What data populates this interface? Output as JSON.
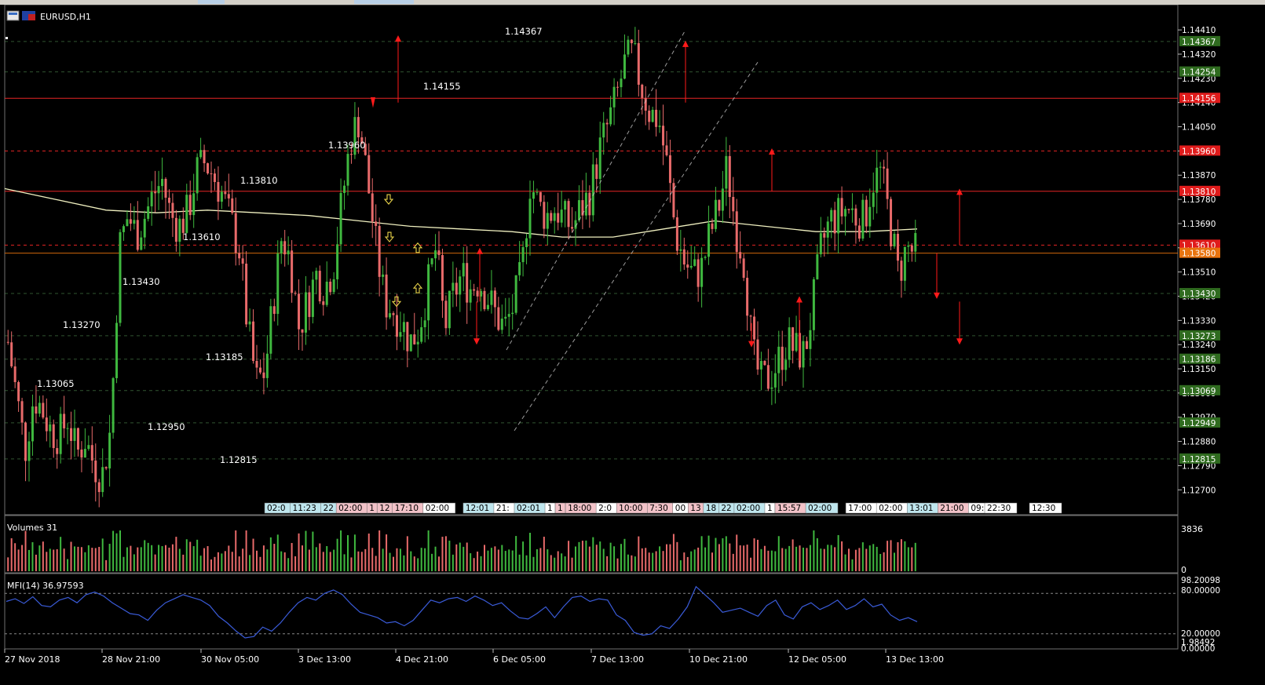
{
  "window": {
    "symbol_label": "EURUSD,H1"
  },
  "colors": {
    "background": "#000000",
    "bull": "#3fb83f",
    "bear": "#e86a6a",
    "resistance": "#ff2a2a",
    "support_dash": "#5a9a5a",
    "ma": "#f0f0c0",
    "mfi": "#3a5bd8",
    "price_green": "#2f6b1f",
    "price_red": "#e01b1b",
    "price_orange": "#e8730e",
    "arrow_red": "#ff1a1a",
    "arrow_yellow": "#e8d24a"
  },
  "chart_data": {
    "type": "candlestick",
    "symbol": "EURUSD",
    "timeframe": "H1",
    "ylim": [
      1.1266,
      1.1446
    ],
    "y_ticks": [
      "1.14410",
      "1.14320",
      "1.14230",
      "1.14140",
      "1.14050",
      "1.13960",
      "1.13870",
      "1.13780",
      "1.13690",
      "1.13600",
      "1.13510",
      "1.13420",
      "1.13330",
      "1.13240",
      "1.13150",
      "1.13060",
      "1.12970",
      "1.12880",
      "1.12790",
      "1.12700"
    ],
    "x_ticks": [
      "27 Nov 2018",
      "28 Nov 21:00",
      "30 Nov 05:00",
      "3 Dec 13:00",
      "4 Dec 21:00",
      "6 Dec 05:00",
      "7 Dec 13:00",
      "10 Dec 21:00",
      "12 Dec 05:00",
      "13 Dec 13:00"
    ],
    "close_path": [
      1.1325,
      1.1305,
      1.1285,
      1.1305,
      1.13,
      1.1292,
      1.129,
      1.1297,
      1.1283,
      1.1289,
      1.128,
      1.1275,
      1.1293,
      1.136,
      1.1372,
      1.1365,
      1.1372,
      1.138,
      1.1385,
      1.1372,
      1.1368,
      1.1373,
      1.1388,
      1.1392,
      1.1387,
      1.138,
      1.137,
      1.136,
      1.133,
      1.131,
      1.1314,
      1.134,
      1.1365,
      1.1355,
      1.133,
      1.134,
      1.135,
      1.1345,
      1.1353,
      1.1377,
      1.14,
      1.1408,
      1.1385,
      1.136,
      1.134,
      1.1337,
      1.1332,
      1.1325,
      1.133,
      1.1345,
      1.136,
      1.133,
      1.1342,
      1.135,
      1.1345,
      1.1348,
      1.1342,
      1.1335,
      1.133,
      1.1338,
      1.135,
      1.1385,
      1.1375,
      1.1372,
      1.1375,
      1.137,
      1.1368,
      1.1375,
      1.138,
      1.1395,
      1.1405,
      1.1415,
      1.1428,
      1.1432,
      1.142,
      1.141,
      1.1408,
      1.139,
      1.1365,
      1.1355,
      1.135,
      1.1352,
      1.1365,
      1.1375,
      1.139,
      1.1368,
      1.1355,
      1.132,
      1.131,
      1.1312,
      1.1318,
      1.1325,
      1.1322,
      1.132,
      1.1338,
      1.136,
      1.137,
      1.1372,
      1.1375,
      1.1372,
      1.137,
      1.1385,
      1.1388,
      1.137,
      1.135,
      1.136,
      1.1358
    ],
    "ma_path": [
      1.1382,
      1.1378,
      1.1374,
      1.1373,
      1.1374,
      1.1373,
      1.1372,
      1.137,
      1.1368,
      1.1367,
      1.1366,
      1.1364,
      1.1364,
      1.1367,
      1.137,
      1.1368,
      1.1366,
      1.1366,
      1.1367
    ],
    "price_annotations": [
      "1.14367",
      "1.14155",
      "1.13960",
      "1.13810",
      "1.13610",
      "1.13430",
      "1.13270",
      "1.13185",
      "1.13065",
      "1.12950",
      "1.12815"
    ],
    "horizontal_levels": [
      {
        "price": 1.14156,
        "label": "1.14156",
        "style": "solid",
        "color": "red"
      },
      {
        "price": 1.1396,
        "label": "1.13960",
        "style": "dash",
        "color": "red"
      },
      {
        "price": 1.1381,
        "label": "1.13810",
        "style": "solid",
        "color": "red"
      },
      {
        "price": 1.1361,
        "label": "1.13610",
        "style": "dash",
        "color": "red"
      },
      {
        "price": 1.1358,
        "label": "1.13580",
        "style": "solid",
        "color": "orange"
      },
      {
        "price": 1.14367,
        "label": "1.14367",
        "style": "dash",
        "color": "green"
      },
      {
        "price": 1.14254,
        "label": "1.14254",
        "style": "dash",
        "color": "green"
      },
      {
        "price": 1.1343,
        "label": "1.13430",
        "style": "dash",
        "color": "green"
      },
      {
        "price": 1.13273,
        "label": "1.13273",
        "style": "dash",
        "color": "green"
      },
      {
        "price": 1.13186,
        "label": "1.13186",
        "style": "dash",
        "color": "green"
      },
      {
        "price": 1.13069,
        "label": "1.13069",
        "style": "dash",
        "color": "green"
      },
      {
        "price": 1.12949,
        "label": "1.12949",
        "style": "dash",
        "color": "green"
      },
      {
        "price": 1.12815,
        "label": "1.12815",
        "style": "dash",
        "color": "green"
      }
    ],
    "time_markers": [
      {
        "text": "02:0",
        "tone": "cyan"
      },
      {
        "text": "11:23",
        "tone": "cyan"
      },
      {
        "text": "22",
        "tone": "cyan"
      },
      {
        "text": "02:00",
        "tone": "pink"
      },
      {
        "text": "1",
        "tone": "pink"
      },
      {
        "text": "12",
        "tone": "pink"
      },
      {
        "text": "17:10",
        "tone": "pink"
      },
      {
        "text": "02:00",
        "tone": "white"
      },
      {
        "text": "12:01",
        "tone": "cyan"
      },
      {
        "text": "21:",
        "tone": "white"
      },
      {
        "text": "02:01",
        "tone": "cyan"
      },
      {
        "text": "1",
        "tone": "white"
      },
      {
        "text": "1",
        "tone": "pink"
      },
      {
        "text": "18:00",
        "tone": "pink"
      },
      {
        "text": "2:0",
        "tone": "white"
      },
      {
        "text": "10:00",
        "tone": "pink"
      },
      {
        "text": "7:30",
        "tone": "pink"
      },
      {
        "text": "00",
        "tone": "white"
      },
      {
        "text": "13",
        "tone": "pink"
      },
      {
        "text": "18",
        "tone": "cyan"
      },
      {
        "text": "22",
        "tone": "cyan"
      },
      {
        "text": "02:00",
        "tone": "cyan"
      },
      {
        "text": "1",
        "tone": "white"
      },
      {
        "text": "15:57",
        "tone": "pink"
      },
      {
        "text": "02:00",
        "tone": "cyan"
      },
      {
        "text": "17:00",
        "tone": "white"
      },
      {
        "text": "02:00",
        "tone": "white"
      },
      {
        "text": "13:01",
        "tone": "cyan"
      },
      {
        "text": "21:00",
        "tone": "pink"
      },
      {
        "text": "09:00",
        "tone": "white"
      },
      {
        "text": "22:30",
        "tone": "white"
      },
      {
        "text": "12:30",
        "tone": "white"
      }
    ],
    "volumes": {
      "label": "Volumes 31",
      "axis_top": "3836",
      "axis_bottom": "0"
    },
    "mfi": {
      "label": "MFI(14) 36.97593",
      "axis_labels": [
        "98.20098",
        "80.00000",
        "20.00000",
        "1.98492",
        "0.00000"
      ],
      "levels": [
        80,
        20
      ],
      "path": [
        68,
        72,
        65,
        75,
        62,
        60,
        70,
        74,
        66,
        78,
        82,
        76,
        66,
        58,
        50,
        48,
        40,
        55,
        66,
        72,
        78,
        74,
        70,
        62,
        46,
        36,
        24,
        14,
        16,
        30,
        24,
        36,
        52,
        66,
        74,
        70,
        80,
        85,
        78,
        64,
        52,
        48,
        44,
        36,
        38,
        32,
        40,
        55,
        70,
        66,
        72,
        74,
        68,
        76,
        70,
        62,
        66,
        54,
        44,
        42,
        50,
        60,
        44,
        60,
        74,
        76,
        68,
        72,
        70,
        48,
        40,
        22,
        18,
        20,
        32,
        28,
        42,
        60,
        90,
        78,
        66,
        52,
        55,
        58,
        52,
        46,
        62,
        70,
        48,
        42,
        60,
        66,
        56,
        62,
        70,
        56,
        62,
        72,
        60,
        64,
        48,
        40,
        44,
        38
      ]
    }
  }
}
